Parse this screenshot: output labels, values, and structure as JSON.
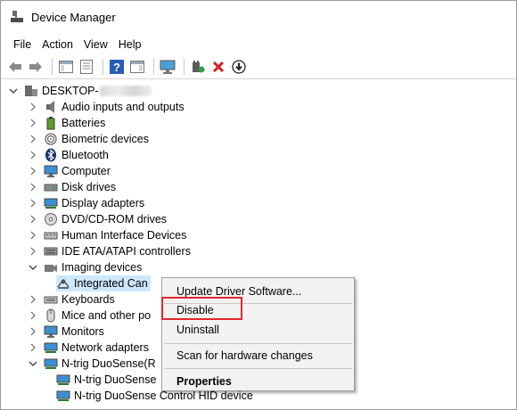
{
  "window": {
    "title": "Device Manager"
  },
  "menu": [
    "File",
    "Action",
    "View",
    "Help"
  ],
  "toolbar": {
    "buttons": [
      "back-arrow-icon",
      "forward-arrow-icon",
      "show-hide-console-tree-icon",
      "properties-icon",
      "help-icon",
      "action-pane-icon",
      "monitor-icon",
      "update-driver-icon",
      "uninstall-x-icon",
      "disable-download-icon"
    ]
  },
  "tree": {
    "root": "DESKTOP-",
    "items": [
      {
        "label": "Audio inputs and outputs"
      },
      {
        "label": "Batteries"
      },
      {
        "label": "Biometric devices"
      },
      {
        "label": "Bluetooth"
      },
      {
        "label": "Computer"
      },
      {
        "label": "Disk drives"
      },
      {
        "label": "Display adapters"
      },
      {
        "label": "DVD/CD-ROM drives"
      },
      {
        "label": "Human Interface Devices"
      },
      {
        "label": "IDE ATA/ATAPI controllers"
      },
      {
        "label": "Imaging devices"
      },
      {
        "label": "Integrated Can"
      },
      {
        "label": "Keyboards"
      },
      {
        "label": "Mice and other po"
      },
      {
        "label": "Monitors"
      },
      {
        "label": "Network adapters"
      },
      {
        "label": "N-trig DuoSense(R"
      },
      {
        "label": "N-trig DuoSense"
      },
      {
        "label": "N-trig DuoSense Control HID device"
      }
    ]
  },
  "context_menu": {
    "update": "Update Driver Software...",
    "disable": "Disable",
    "uninstall": "Uninstall",
    "scan": "Scan for hardware changes",
    "properties": "Properties"
  },
  "colors": {
    "highlight_box": "#e0282d",
    "selection": "#cce8ff"
  }
}
